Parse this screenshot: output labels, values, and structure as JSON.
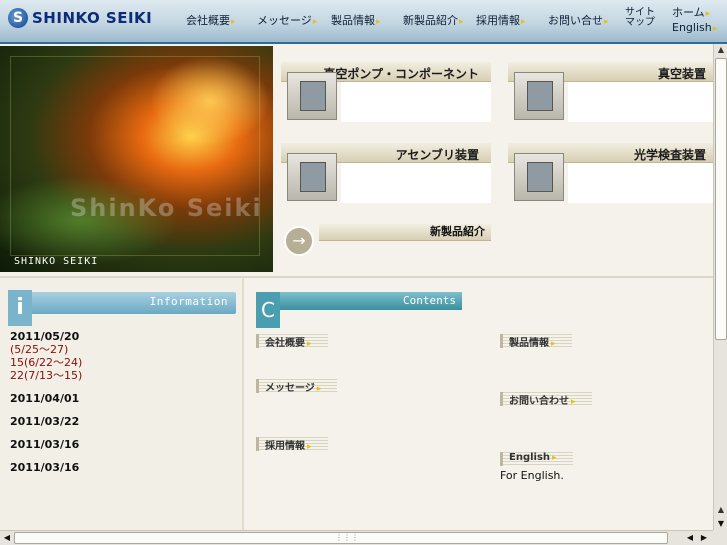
{
  "brand": {
    "logo_text": "SHINKO SEIKI",
    "logo_mark": "S"
  },
  "nav": {
    "items": [
      {
        "label": "会社概要"
      },
      {
        "label": "メッセージ"
      },
      {
        "label": "製品情報"
      },
      {
        "label": "新製品紹介"
      },
      {
        "label": "採用情報"
      },
      {
        "label": "お問い合せ"
      }
    ],
    "sitemap_line1": "サイト",
    "sitemap_line2": "マップ",
    "home": "ホーム",
    "english": "English"
  },
  "hero": {
    "ghost_text": "ShinKo Seiki",
    "brand_text": "SHINKO SEIKI"
  },
  "products": [
    {
      "title": "真空ポンプ・コンポーネント",
      "desc_line1": "",
      "desc_line2": ""
    },
    {
      "title": "真空装置",
      "desc_line1": "",
      "desc_line2": ""
    },
    {
      "title": "アセンブリ装置",
      "desc_line1": "",
      "desc_line2": ""
    },
    {
      "title": "光学検査装置",
      "desc_line1": "",
      "desc_line2": ""
    }
  ],
  "new_products": {
    "label": "新製品紹介",
    "text": ""
  },
  "information": {
    "header": "Information",
    "entries": [
      {
        "date": "2011/05/20",
        "lines": [
          "",
          "(5/25〜27)",
          "15(6/22〜24)",
          "22(7/13〜15)"
        ]
      },
      {
        "date": "2011/04/01",
        "lines": [
          ""
        ]
      },
      {
        "date": "2011/03/22",
        "lines": [
          ""
        ]
      },
      {
        "date": "2011/03/16",
        "lines": [
          ""
        ]
      },
      {
        "date": "2011/03/16",
        "lines": []
      }
    ]
  },
  "contents": {
    "header": "Contents",
    "badge": "C",
    "sections": [
      {
        "heading": "会社概要",
        "body": ""
      },
      {
        "heading": "製品情報",
        "body": ""
      },
      {
        "heading": "メッセージ",
        "body": ""
      },
      {
        "heading": "お問い合わせ",
        "body": ""
      },
      {
        "heading": "採用情報",
        "body": ""
      },
      {
        "heading": "English",
        "body": "For English."
      }
    ]
  },
  "colors": {
    "nav_bar": "#c3d6e2",
    "nav_border": "#2d6d97",
    "news_link": "#8a0d0d",
    "info_bar": "#6aa9c4",
    "contents_bar": "#3b8f9e",
    "arrow": "#e5c21a"
  }
}
